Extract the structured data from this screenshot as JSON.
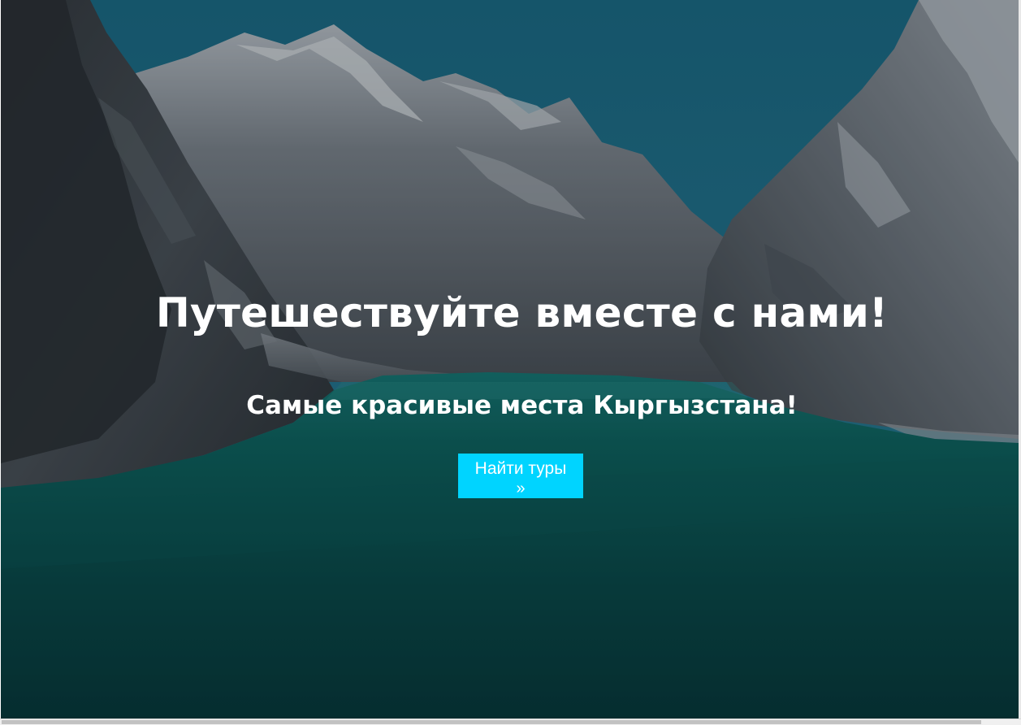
{
  "hero": {
    "title": "Путешествуйте вместе с нами!",
    "subtitle": "Самые красивые места Кыргызстана!",
    "background_image": "mountain-lake-background",
    "cta": {
      "label": "Найти туры",
      "arrow": "»"
    }
  },
  "colors": {
    "cta_background": "#00d4ff",
    "text": "#ffffff",
    "sky": "#1f6f86",
    "water": "#0f5f60",
    "rock": "#6f7882"
  }
}
